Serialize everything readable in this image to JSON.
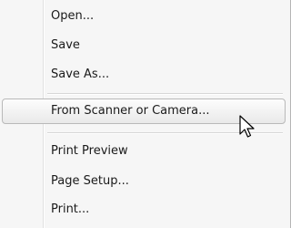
{
  "menu": {
    "items": {
      "open": "Open...",
      "save": "Save",
      "save_as": "Save As...",
      "from_scanner": "From Scanner or Camera...",
      "print_preview": "Print Preview",
      "page_setup": "Page Setup...",
      "print": "Print..."
    },
    "hovered_item": "From Scanner or Camera..."
  },
  "cursor_icon": "mouse-pointer-icon"
}
